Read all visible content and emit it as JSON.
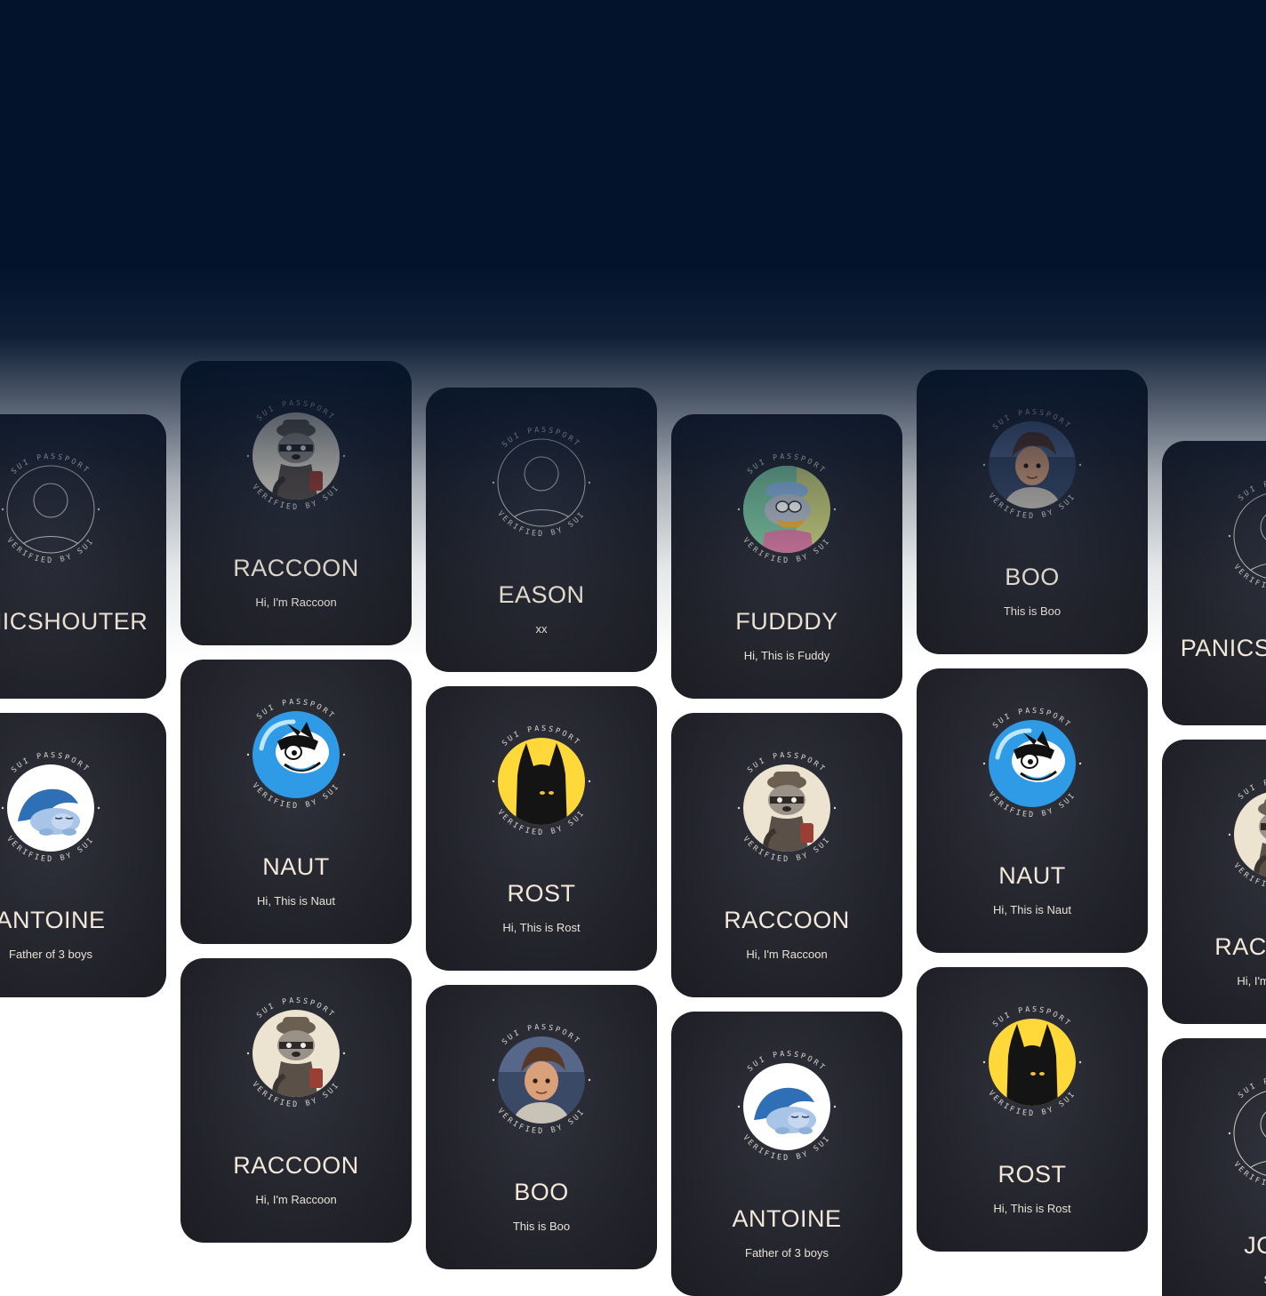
{
  "ring": {
    "top": "SUI PASSPORT",
    "bottom": "VERIFIED BY SUI"
  },
  "cards": [
    {
      "name": "PANICSHOUTER",
      "bio": "",
      "avatar": "placeholder"
    },
    {
      "name": "ANTOINE",
      "bio": "Father of 3 boys",
      "avatar": "sleeping-bear"
    },
    {
      "name": "RACCOON",
      "bio": "Hi, I'm Raccoon",
      "avatar": "raccoon"
    },
    {
      "name": "NAUT",
      "bio": "Hi, This is Naut",
      "avatar": "naut"
    },
    {
      "name": "RACCOON",
      "bio": "Hi, I'm Raccoon",
      "avatar": "raccoon"
    },
    {
      "name": "EASON",
      "bio": "xx",
      "avatar": "placeholder"
    },
    {
      "name": "ROST",
      "bio": "Hi, This is Rost",
      "avatar": "rost"
    },
    {
      "name": "BOO",
      "bio": "This is Boo",
      "avatar": "boo"
    },
    {
      "name": "FUDDDY",
      "bio": "Hi, This is Fuddy",
      "avatar": "fuddy"
    },
    {
      "name": "RACCOON",
      "bio": "Hi, I'm Raccoon",
      "avatar": "raccoon"
    },
    {
      "name": "ANTOINE",
      "bio": "Father of 3 boys",
      "avatar": "sleeping-bear"
    },
    {
      "name": "BOO",
      "bio": "This is Boo",
      "avatar": "boo"
    },
    {
      "name": "NAUT",
      "bio": "Hi, This is Naut",
      "avatar": "naut"
    },
    {
      "name": "ROST",
      "bio": "Hi, This is Rost",
      "avatar": "rost"
    },
    {
      "name": "PANICSHOUTER",
      "bio": "",
      "avatar": "placeholder"
    },
    {
      "name": "RACCOON",
      "bio": "Hi, I'm Raccoon",
      "avatar": "raccoon"
    },
    {
      "name": "JOHN",
      "bio": "Short",
      "avatar": "placeholder"
    }
  ]
}
